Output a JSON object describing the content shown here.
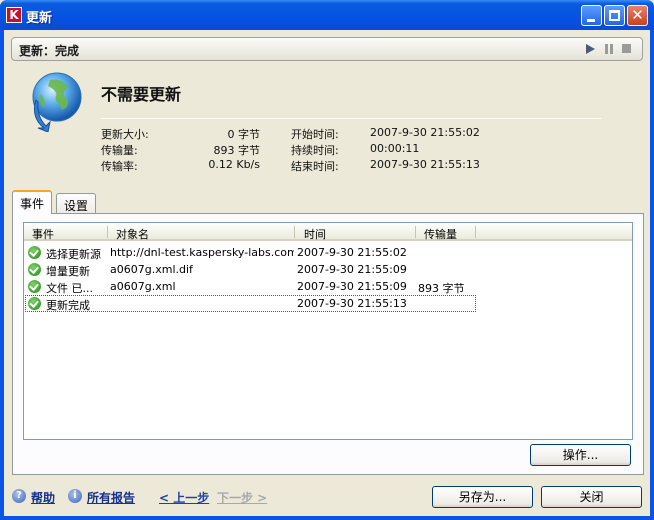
{
  "window": {
    "title": "更新",
    "logo_letter": "K"
  },
  "status": {
    "text": "更新：完成"
  },
  "summary": {
    "headline": "不需要更新",
    "stats": {
      "size_label": "更新大小:",
      "size_value": "0 字节",
      "transferred_label": "传输量:",
      "transferred_value": "893 字节",
      "rate_label": "传输率:",
      "rate_value": "0.12 Kb/s",
      "start_label": "开始时间:",
      "start_value": "2007-9-30 21:55:02",
      "duration_label": "持续时间:",
      "duration_value": "00:00:11",
      "end_label": "结束时间:",
      "end_value": "2007-9-30 21:55:13"
    }
  },
  "tabs": [
    {
      "label": "事件"
    },
    {
      "label": "设置"
    }
  ],
  "events": {
    "columns": [
      "事件",
      "对象名",
      "时间",
      "传输量"
    ],
    "rows": [
      {
        "event": "选择更新源",
        "object": "http://dnl-test.kaspersky-labs.com/...",
        "time": "2007-9-30 21:55:02",
        "transfer": ""
      },
      {
        "event": "增量更新",
        "object": "a0607g.xml.dif",
        "time": "2007-9-30 21:55:09",
        "transfer": ""
      },
      {
        "event": "文件 已...",
        "object": "a0607g.xml",
        "time": "2007-9-30 21:55:09",
        "transfer": "893 字节"
      },
      {
        "event": "更新完成",
        "object": "",
        "time": "2007-9-30 21:55:13",
        "transfer": ""
      }
    ],
    "action_button": "操作..."
  },
  "footer": {
    "help": "帮助",
    "all_reports": "所有报告",
    "prev": "< 上一步",
    "next": "下一步 >",
    "save_as": "另存为...",
    "close": "关闭"
  }
}
